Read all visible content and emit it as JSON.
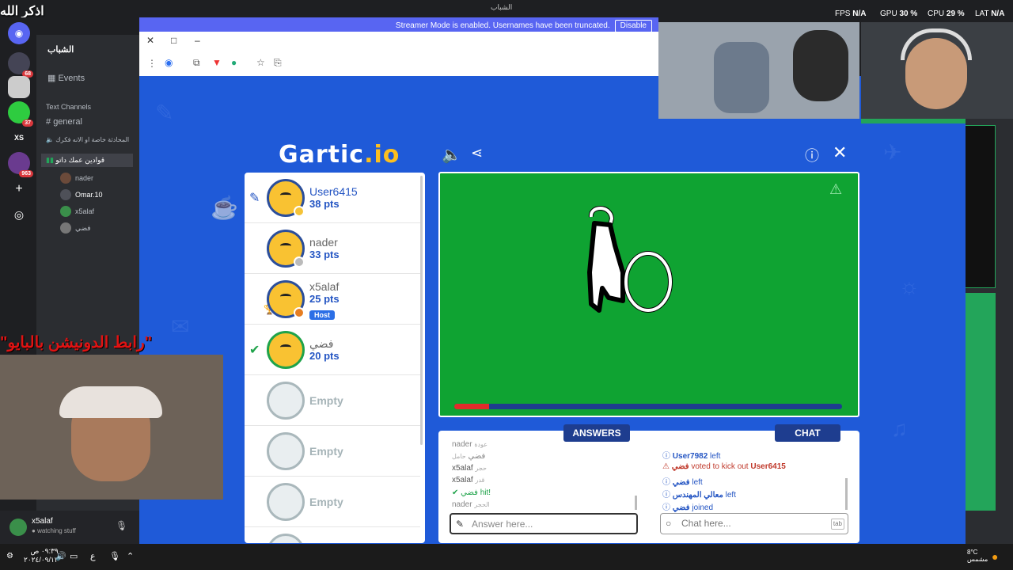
{
  "overlay": {
    "zikr": "اذكر الله",
    "donation_text": "\"رابط الدونيشن بالبايو\""
  },
  "window_title": "الشباب",
  "stats": {
    "fps_label": "FPS",
    "fps": "N/A",
    "gpu_label": "GPU",
    "gpu": "30 %",
    "cpu_label": "CPU",
    "cpu": "29 %",
    "lat_label": "LAT",
    "lat": "N/A"
  },
  "streamer_notice": {
    "text": "Streamer Mode is enabled. Usernames have been truncated.",
    "button": "Disable"
  },
  "discord": {
    "server_name": "الشباب",
    "events": "Events",
    "text_channels": "Text Channels",
    "channels": [
      "general",
      "المحادثة خاصة او الانه فكرك"
    ],
    "voice_channel": "قوادين عمك داتو",
    "voice_users": [
      "nader",
      "Omar.10",
      "x5alaf",
      "فضي"
    ],
    "badges": [
      "68",
      "37",
      "963"
    ],
    "xs": "XS",
    "user": {
      "name": "x5alaf",
      "status": "watching stuff"
    }
  },
  "game": {
    "logo_main": "Gartic",
    "logo_suffix": ".io",
    "players": [
      {
        "name": "User6415",
        "pts": "38 pts",
        "dot": "#f5c338"
      },
      {
        "name": "nader",
        "pts": "33 pts",
        "dot": "#bbbbbb"
      },
      {
        "name": "x5alaf",
        "pts": "25 pts",
        "dot": "#e67e22",
        "host": "Host"
      },
      {
        "name": "فضي",
        "pts": "20 pts"
      }
    ],
    "empty_label": "Empty",
    "timer_fraction": 0.09,
    "answers_tab": "ANSWERS",
    "chat_tab": "CHAT",
    "answers": [
      {
        "user": "nader",
        "text": "عودة"
      },
      {
        "user": "فضي",
        "text": "حامل"
      },
      {
        "user": "x5alaf",
        "text": "حجر"
      },
      {
        "user": "x5alaf",
        "text": "قدر"
      },
      {
        "user": "فضي",
        "text": "hit!"
      },
      {
        "user": "nader",
        "text": "الحجر"
      }
    ],
    "chat": [
      {
        "user": "User7982",
        "text": "left"
      },
      {
        "user": "فضي",
        "text": "voted to kick out",
        "target": "User6415"
      },
      {
        "user": "فضي",
        "text": "left"
      },
      {
        "user": "معالي المهندس",
        "text": "left"
      },
      {
        "user": "فضي",
        "text": "joined"
      }
    ],
    "answer_placeholder": "Answer here...",
    "chat_placeholder": "Chat here...",
    "tab_hint": "tab"
  },
  "taskbar": {
    "time": "٠٩:٣٩ ص",
    "date": "٢٠٢٤/٠٩/١٣",
    "weather": "8°C",
    "weather_desc": "مشمس",
    "lang": "ع"
  }
}
